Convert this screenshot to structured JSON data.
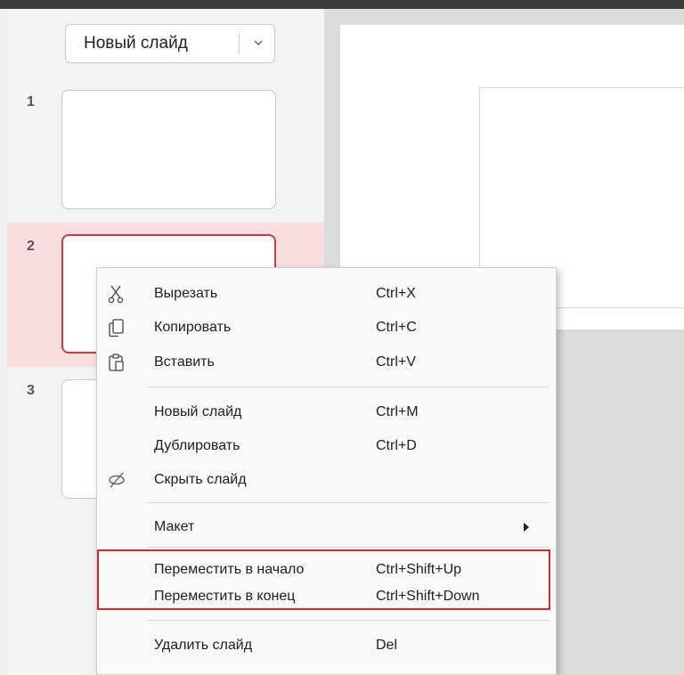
{
  "slide_panel": {
    "new_slide_button": "Новый слайд",
    "slides": [
      {
        "number": "1"
      },
      {
        "number": "2"
      },
      {
        "number": "3"
      }
    ]
  },
  "context_menu": {
    "items": [
      {
        "label": "Вырезать",
        "shortcut": "Ctrl+X",
        "icon": "scissors-icon"
      },
      {
        "label": "Копировать",
        "shortcut": "Ctrl+C",
        "icon": "copy-icon"
      },
      {
        "label": "Вставить",
        "shortcut": "Ctrl+V",
        "icon": "clipboard-icon"
      },
      {
        "label": "Новый слайд",
        "shortcut": "Ctrl+M"
      },
      {
        "label": "Дублировать",
        "shortcut": "Ctrl+D"
      },
      {
        "label": "Скрыть слайд",
        "icon": "eye-slash-icon"
      },
      {
        "label": "Макет",
        "icon": "submenu-arrow-icon"
      },
      {
        "label": "Переместить в начало",
        "shortcut": "Ctrl+Shift+Up"
      },
      {
        "label": "Переместить в конец",
        "shortcut": "Ctrl+Shift+Down"
      },
      {
        "label": "Удалить слайд",
        "shortcut": "Del"
      }
    ]
  },
  "colors": {
    "selected_slide_bg": "#f8dede",
    "selected_slide_border": "#cf3b3b",
    "highlight_box": "#d8282e"
  }
}
